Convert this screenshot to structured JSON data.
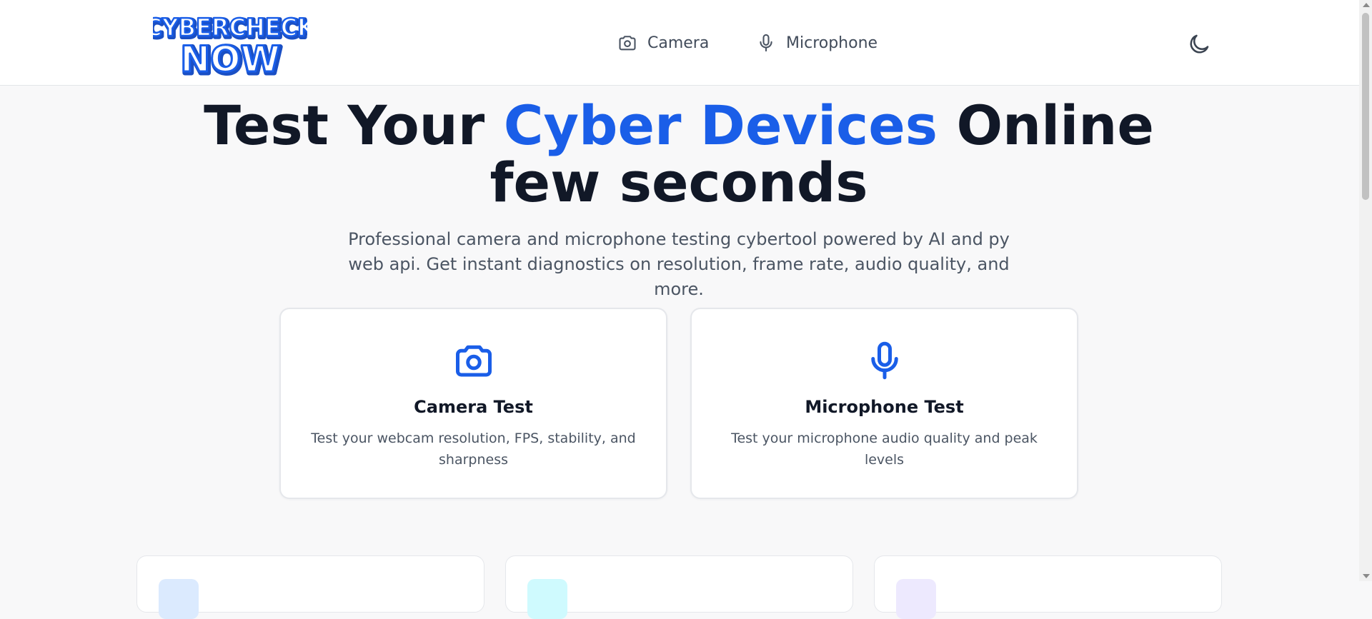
{
  "header": {
    "logo": {
      "line1": "CYBERCHECK",
      "line2": "NOW",
      "icon": "logo"
    },
    "nav": [
      {
        "label": "Camera",
        "icon": "camera-icon"
      },
      {
        "label": "Microphone",
        "icon": "microphone-icon"
      }
    ],
    "theme_toggle_icon": "moon-icon"
  },
  "hero": {
    "title_part1": "Test Your ",
    "title_accent": "Cyber Devices",
    "title_part2": " Online few seconds",
    "subtitle": "Professional camera and microphone testing cybertool powered by AI and py web api. Get instant diagnostics on resolution, frame rate, audio quality, and more."
  },
  "test_cards": [
    {
      "title": "Camera Test",
      "description": "Test your webcam resolution, FPS, stability, and sharpness",
      "icon": "camera-icon"
    },
    {
      "title": "Microphone Test",
      "description": "Test your microphone audio quality and peak levels",
      "icon": "microphone-icon"
    }
  ],
  "colors": {
    "accent": "#1a5ee8",
    "heading": "#111827",
    "body_text": "#4b5563",
    "page_background": "#f8f8f9"
  }
}
